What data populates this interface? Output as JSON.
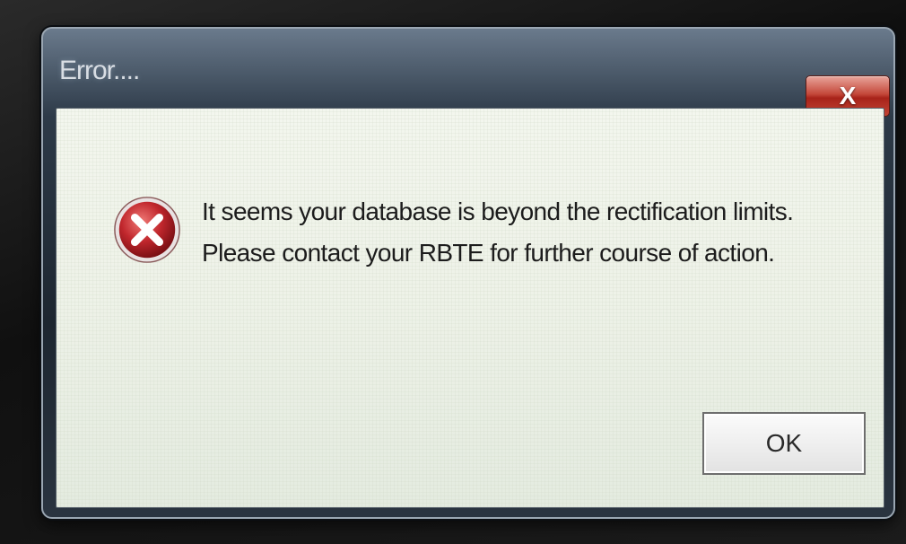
{
  "dialog": {
    "title": "Error....",
    "close_label": "X",
    "icon": "error-icon",
    "message_lines": [
      "It seems your database is beyond the rectification limits.",
      "Please contact your RBTE for further course of action."
    ],
    "ok_label": "OK"
  },
  "colors": {
    "close_button": "#c4483a",
    "error_icon": "#c1272d",
    "content_background": "#eef2e8"
  }
}
